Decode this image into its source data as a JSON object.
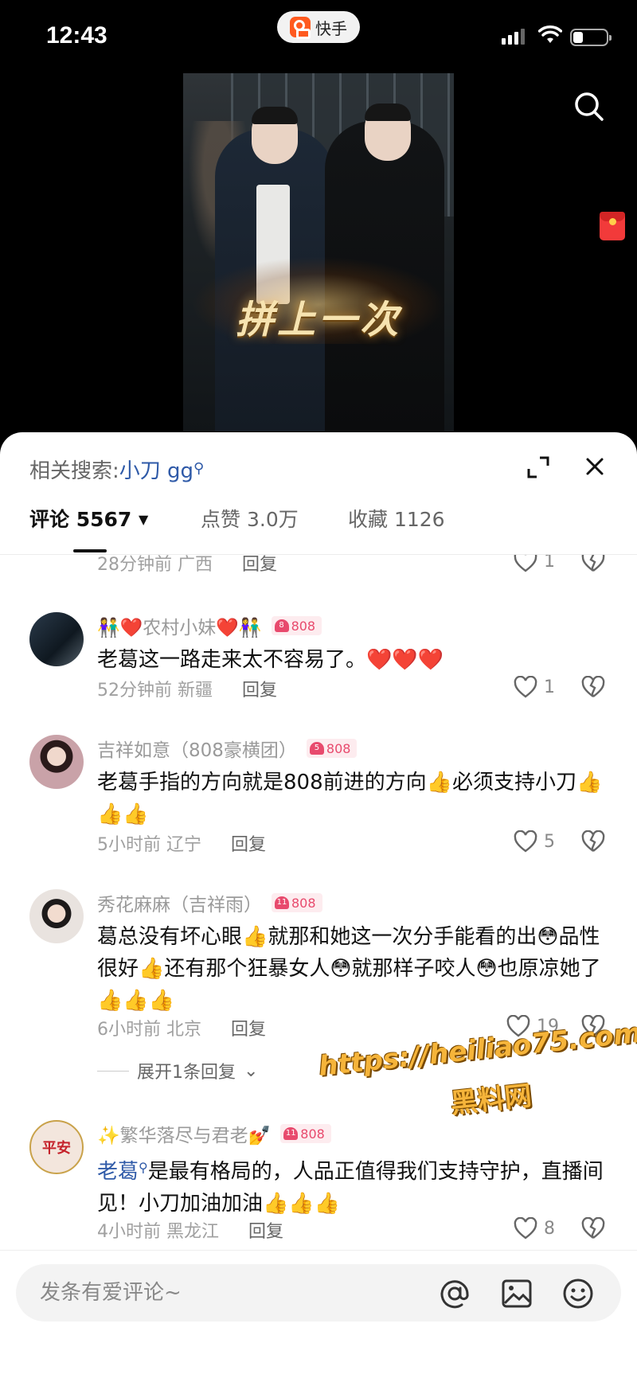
{
  "status": {
    "time": "12:43",
    "app_name": "快手"
  },
  "video": {
    "caption_overlay": "拼上一次"
  },
  "sheet": {
    "related_search_label": "相关搜索:",
    "related_search_keyword": "小刀 gg",
    "tabs": [
      {
        "label": "评论",
        "count": "5567",
        "active": true
      },
      {
        "label": "点赞",
        "count": "3.0万",
        "active": false
      },
      {
        "label": "收藏",
        "count": "1126",
        "active": false
      }
    ]
  },
  "partial_comment": {
    "time": "28分钟前",
    "location": "广西",
    "reply": "回复",
    "likes": "1"
  },
  "comments": [
    {
      "name": "👫❤️农村小妹❤️👫",
      "badge": "808",
      "badge_level": "8",
      "text": "老葛这一路走来太不容易了。❤️❤️❤️",
      "time": "52分钟前",
      "location": "新疆",
      "reply": "回复",
      "likes": "1"
    },
    {
      "name": "吉祥如意（808豪横团）",
      "badge": "808",
      "badge_level": "5",
      "text": "老葛手指的方向就是808前进的方向👍必须支持小刀👍👍👍",
      "time": "5小时前",
      "location": "辽宁",
      "reply": "回复",
      "likes": "5"
    },
    {
      "name": "秀花麻麻（吉祥雨）",
      "badge": "808",
      "badge_level": "11",
      "text": "葛总没有坏心眼👍就那和她这一次分手能看的出😳品性很好👍还有那个狂暴女人😳就那样子咬人😳也原凉她了👍👍👍",
      "time": "6小时前",
      "location": "北京",
      "reply": "回复",
      "likes": "19",
      "expand_replies": "展开1条回复"
    },
    {
      "name": "✨繁华落尽与君老💅",
      "badge": "808",
      "badge_level": "11",
      "text_link": "老葛",
      "text": "是最有格局的，人品正值得我们支持守护，直播间见！小刀加油加油👍👍👍",
      "time": "4小时前",
      "location": "黑龙江",
      "reply": "回复",
      "likes": "8",
      "avatar_text": "平安"
    }
  ],
  "watermark": {
    "line1": "https://heiliao75.com",
    "line2": "黑料网"
  },
  "input": {
    "placeholder": "发条有爱评论~"
  },
  "icons": {
    "search": "search-icon",
    "expand": "expand-icon",
    "close": "close-icon",
    "like": "heart-outline-icon",
    "dislike": "broken-heart-icon",
    "at": "at-icon",
    "image": "image-icon",
    "emoji": "emoji-icon"
  },
  "colors": {
    "link": "#2f5aa8",
    "badge": "#e84a6d",
    "muted": "#a0a0a0"
  }
}
